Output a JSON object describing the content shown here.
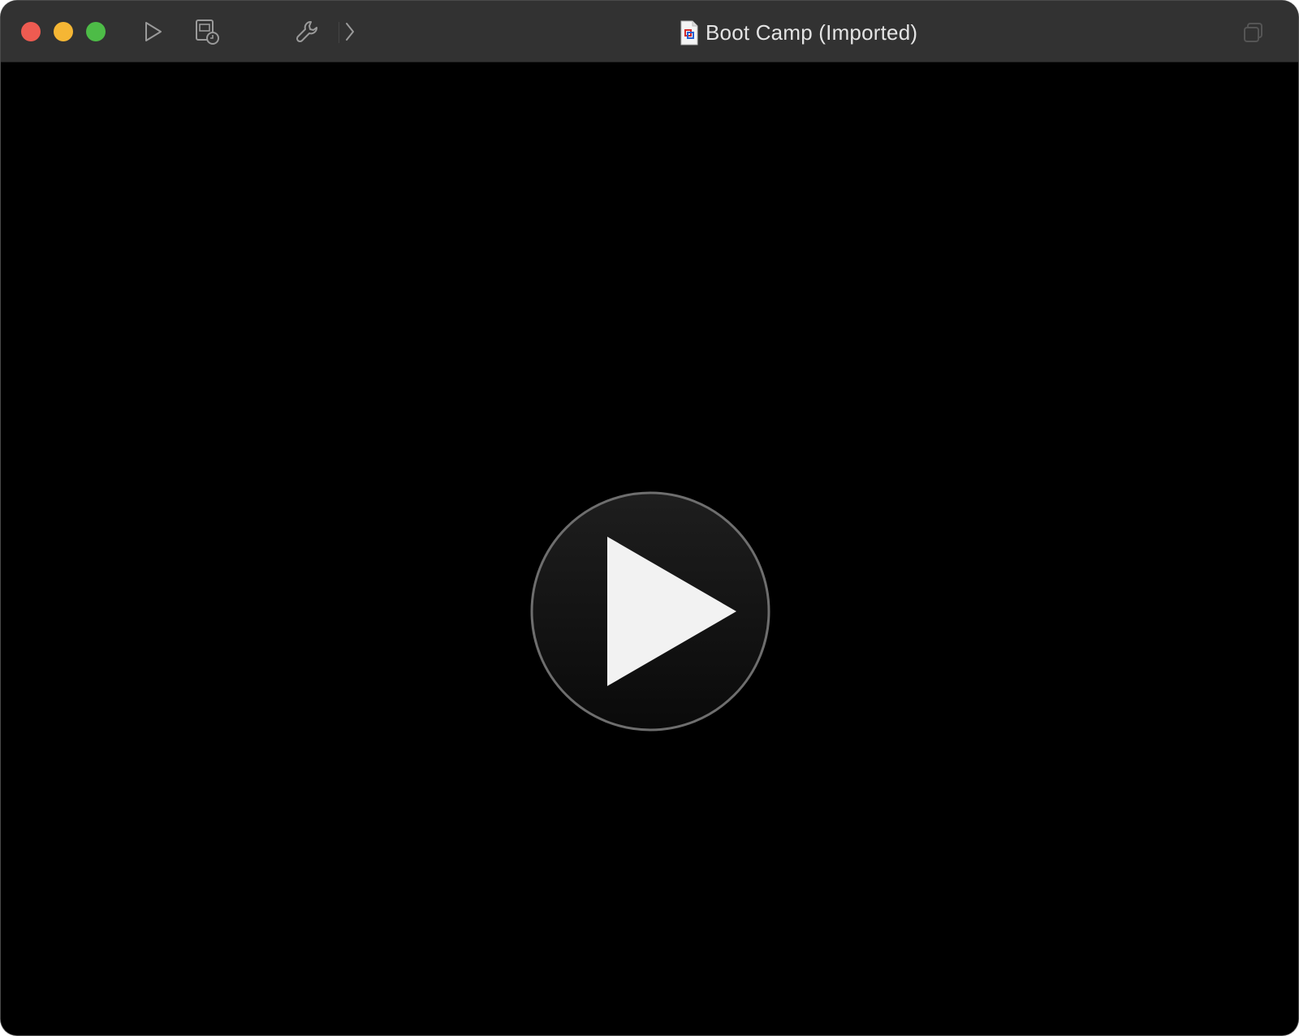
{
  "window": {
    "title": "Boot Camp (Imported)"
  },
  "traffic_lights": {
    "close_color": "#ee5b51",
    "minimize_color": "#f5b634",
    "zoom_color": "#4dbc47"
  },
  "toolbar": {
    "buttons": [
      {
        "name": "start-vm",
        "icon": "play-outline-icon"
      },
      {
        "name": "snapshots",
        "icon": "snapshot-clock-icon"
      },
      {
        "name": "configure",
        "icon": "wrench-icon"
      },
      {
        "name": "more",
        "icon": "chevron-right-icon"
      }
    ],
    "right_icon": "window-stack-icon"
  },
  "main": {
    "background": "#000000",
    "center_icon": "play-circle-icon"
  }
}
